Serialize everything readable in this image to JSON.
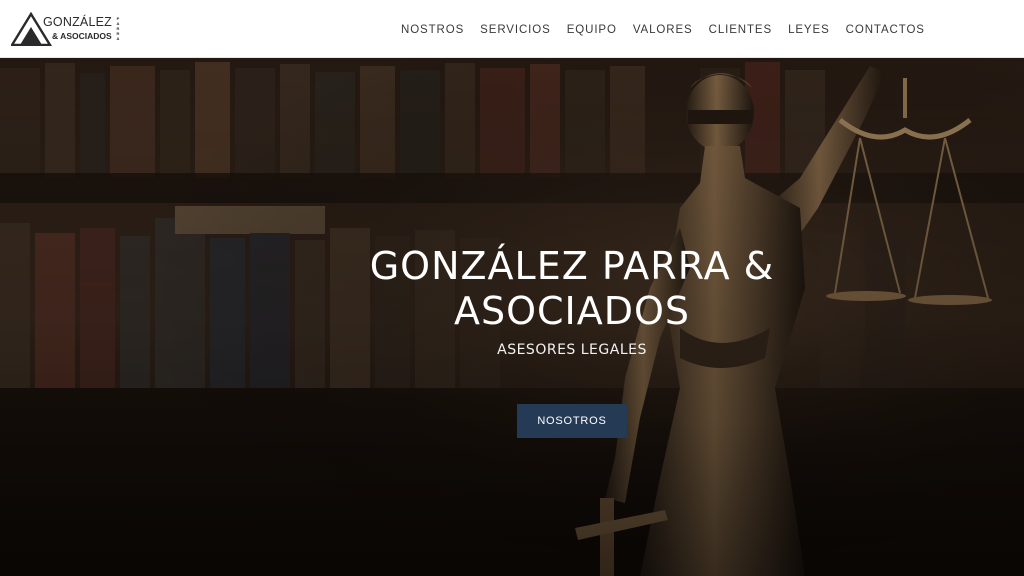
{
  "brand": {
    "name": "GONZÁLEZ",
    "sub": "& ASOCIADOS",
    "vertical": "PARRA",
    "mark": "scales-triangle-logo"
  },
  "nav": {
    "items": [
      "NOSTROS",
      "SERVICIOS",
      "EQUIPO",
      "VALORES",
      "CLIENTES",
      "LEYES",
      "CONTACTOS"
    ]
  },
  "hero": {
    "title_line1": "GONZÁLEZ PARRA &",
    "title_line2": "ASOCIADOS",
    "subtitle": "ASESORES LEGALES",
    "button_label": "NOSOTROS",
    "image": "lady-justice-statue-library"
  },
  "colors": {
    "header_bg": "#ffffff",
    "button_bg": "#253a55",
    "nav_text": "#3a3a3a"
  }
}
